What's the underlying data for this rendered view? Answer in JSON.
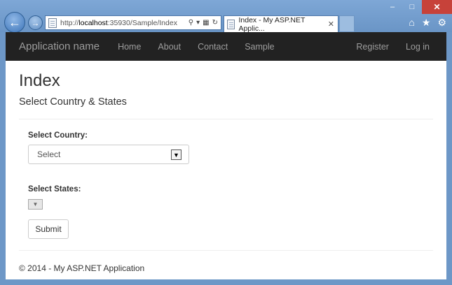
{
  "browser": {
    "url_prefix": "http://",
    "url_host": "localhost",
    "url_rest": ":35930/Sample/Index",
    "tab_title": "Index - My ASP.NET Applic...",
    "icons": {
      "back": "back-arrow-icon",
      "forward": "forward-arrow-icon",
      "search": "search-icon",
      "dropdown": "dropdown-arrow-icon",
      "compat": "compatibility-view-icon",
      "refresh": "refresh-icon",
      "tab_close": "close-icon",
      "home": "home-icon",
      "favorites": "star-icon",
      "settings": "gear-icon"
    },
    "window": {
      "minimize": "–",
      "maximize": "□",
      "close": "✕"
    }
  },
  "navbar": {
    "brand": "Application name",
    "links": [
      "Home",
      "About",
      "Contact",
      "Sample"
    ],
    "right_links": [
      "Register",
      "Log in"
    ]
  },
  "page": {
    "title": "Index",
    "subtitle": "Select Country & States",
    "country_label": "Select Country:",
    "country_selected": "Select",
    "states_label": "Select States:",
    "submit_label": "Submit",
    "footer": "© 2014 - My ASP.NET Application"
  }
}
